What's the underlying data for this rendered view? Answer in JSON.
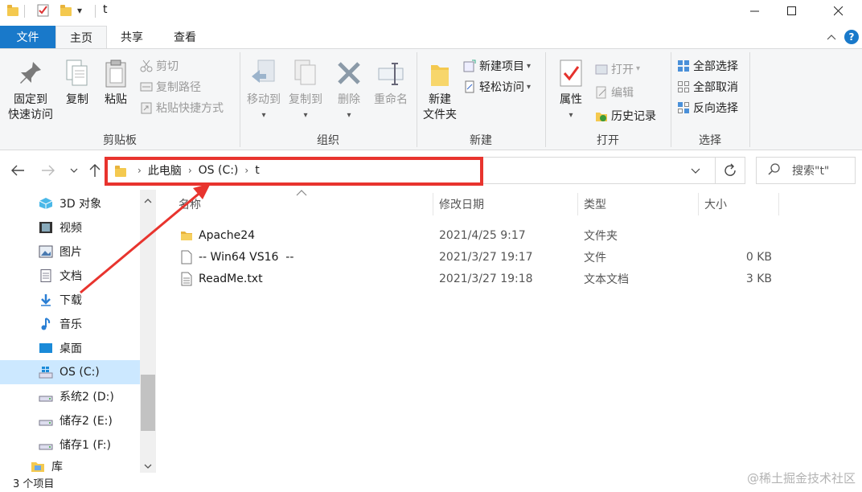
{
  "window": {
    "title": "t",
    "qat_dropdown": "▾"
  },
  "tabs": [
    {
      "label": "文件"
    },
    {
      "label": "主页"
    },
    {
      "label": "共享"
    },
    {
      "label": "查看"
    }
  ],
  "ribbon": {
    "clipboard": {
      "group_label": "剪贴板",
      "pin_line1": "固定到",
      "pin_line2": "快速访问",
      "copy": "复制",
      "paste": "粘贴",
      "cut": "剪切",
      "copy_path": "复制路径",
      "paste_shortcut": "粘贴快捷方式"
    },
    "organize": {
      "group_label": "组织",
      "move_to": "移动到",
      "copy_to": "复制到",
      "delete": "删除",
      "rename": "重命名"
    },
    "new": {
      "group_label": "新建",
      "new_folder_line1": "新建",
      "new_folder_line2": "文件夹",
      "new_item": "新建项目",
      "easy_access": "轻松访问"
    },
    "open": {
      "group_label": "打开",
      "properties": "属性",
      "open": "打开",
      "edit": "编辑",
      "history": "历史记录"
    },
    "select": {
      "group_label": "选择",
      "select_all": "全部选择",
      "select_none": "全部取消",
      "invert": "反向选择"
    }
  },
  "address": {
    "crumbs": [
      "此电脑",
      "OS (C:)",
      "t"
    ],
    "search_placeholder": "搜索\"t\""
  },
  "nav_pane": {
    "items": [
      {
        "label": "3D 对象",
        "icon": "3d-objects-icon"
      },
      {
        "label": "视频",
        "icon": "video-icon"
      },
      {
        "label": "图片",
        "icon": "pictures-icon"
      },
      {
        "label": "文档",
        "icon": "documents-icon"
      },
      {
        "label": "下载",
        "icon": "download-icon"
      },
      {
        "label": "音乐",
        "icon": "music-icon"
      },
      {
        "label": "桌面",
        "icon": "desktop-icon"
      },
      {
        "label": "OS (C:)",
        "icon": "windows-drive-icon",
        "selected": true
      },
      {
        "label": "系统2 (D:)",
        "icon": "drive-icon"
      },
      {
        "label": "储存2 (E:)",
        "icon": "drive-icon"
      },
      {
        "label": "储存1 (F:)",
        "icon": "drive-icon"
      },
      {
        "label": "库",
        "icon": "library-icon"
      }
    ]
  },
  "file_list": {
    "columns": {
      "name": "名称",
      "modified": "修改日期",
      "type": "类型",
      "size": "大小"
    },
    "rows": [
      {
        "name": "Apache24",
        "modified": "2021/4/25 9:17",
        "type": "文件夹",
        "size": "",
        "icon": "folder-icon"
      },
      {
        "name": "-- Win64 VS16  --",
        "modified": "2021/3/27 19:17",
        "type": "文件",
        "size": "0 KB",
        "icon": "file-icon"
      },
      {
        "name": "ReadMe.txt",
        "modified": "2021/3/27 19:18",
        "type": "文本文档",
        "size": "3 KB",
        "icon": "text-file-icon"
      }
    ]
  },
  "status": {
    "item_count": "3 个项目"
  },
  "watermark": "@稀土掘金技术社区",
  "colors": {
    "accent": "#1979ca",
    "selection": "#cce8ff",
    "annotation": "#e8342e",
    "folder": "#f4c94f"
  }
}
